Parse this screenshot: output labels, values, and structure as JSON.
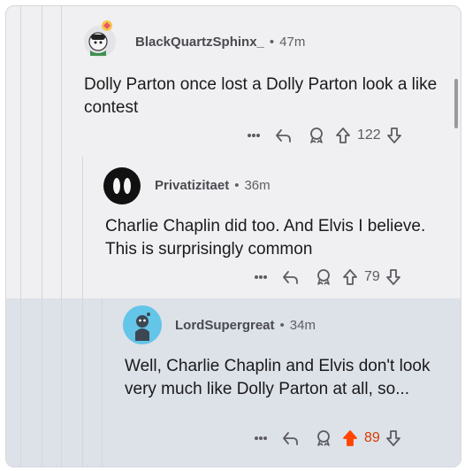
{
  "comments": [
    {
      "username": "BlackQuartzSphinx_",
      "time": "47m",
      "body": "Dolly Parton once lost a Dolly Parton look a like contest",
      "score": "122",
      "voted": false
    },
    {
      "username": "Privatizitaet",
      "time": "36m",
      "body": "Charlie Chaplin did too. And Elvis I believe. This is surprisingly common",
      "score": "79",
      "voted": false
    },
    {
      "username": "LordSupergreat",
      "time": "34m",
      "body": "Well, Charlie Chaplin and Elvis don't look very much like Dolly Parton at all, so...",
      "score": "89",
      "voted": true
    }
  ],
  "separator": "•",
  "colors": {
    "upvote_active": "#ff4500",
    "score_active": "#d93a00",
    "highlight_bg": "#dde1e8"
  },
  "icons": [
    "more-icon",
    "reply-icon",
    "award-icon",
    "upvote-icon",
    "downvote-icon"
  ]
}
